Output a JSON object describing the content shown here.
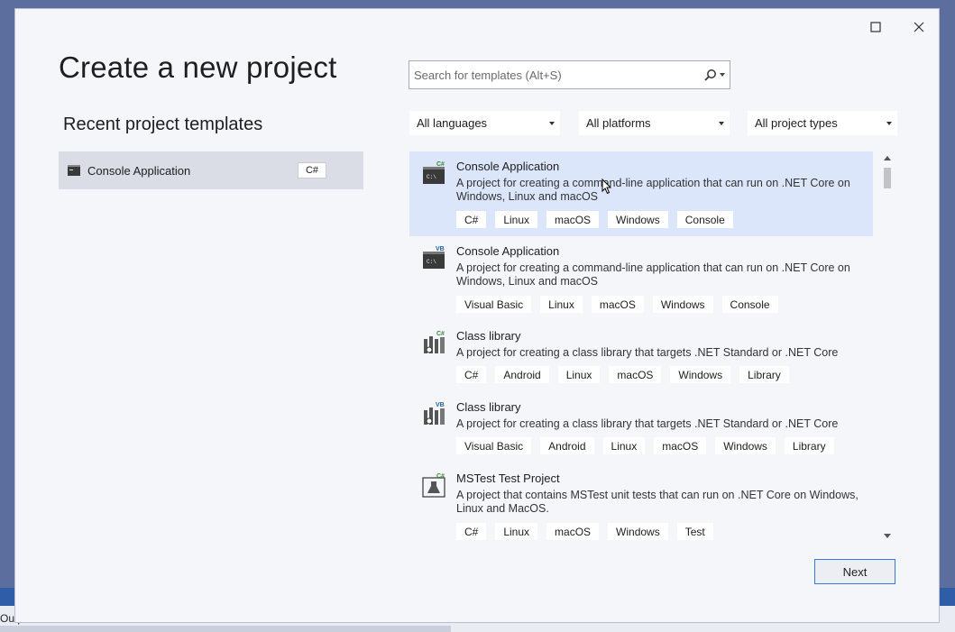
{
  "background": {
    "output_label": "Outpu",
    "accent": "#2f5da8"
  },
  "dialog": {
    "title": "Create a new project",
    "window_controls": {
      "maximize_icon": "maximize-icon",
      "close_icon": "close-icon"
    }
  },
  "recent": {
    "heading": "Recent project templates",
    "items": [
      {
        "label": "Console Application",
        "language": "C#"
      }
    ]
  },
  "search": {
    "placeholder": "Search for templates (Alt+S)",
    "value": ""
  },
  "filters": {
    "language": "All languages",
    "platform": "All platforms",
    "project_type": "All project types"
  },
  "templates": [
    {
      "name": "Console Application",
      "lang_badge": "C#",
      "description": "A project for creating a command-line application that can run on .NET Core on Windows, Linux and macOS",
      "tags": [
        "C#",
        "Linux",
        "macOS",
        "Windows",
        "Console"
      ],
      "selected": true
    },
    {
      "name": "Console Application",
      "lang_badge": "VB",
      "description": "A project for creating a command-line application that can run on .NET Core on Windows, Linux and macOS",
      "tags": [
        "Visual Basic",
        "Linux",
        "macOS",
        "Windows",
        "Console"
      ],
      "selected": false
    },
    {
      "name": "Class library",
      "lang_badge": "C#",
      "description": "A project for creating a class library that targets .NET Standard or .NET Core",
      "tags": [
        "C#",
        "Android",
        "Linux",
        "macOS",
        "Windows",
        "Library"
      ],
      "selected": false
    },
    {
      "name": "Class library",
      "lang_badge": "VB",
      "description": "A project for creating a class library that targets .NET Standard or .NET Core",
      "tags": [
        "Visual Basic",
        "Android",
        "Linux",
        "macOS",
        "Windows",
        "Library"
      ],
      "selected": false
    },
    {
      "name": "MSTest Test Project",
      "lang_badge": "C#",
      "description": "A project that contains MSTest unit tests that can run on .NET Core on Windows, Linux and MacOS.",
      "tags": [
        "C#",
        "Linux",
        "macOS",
        "Windows",
        "Test"
      ],
      "selected": false
    }
  ],
  "buttons": {
    "next": "Next"
  },
  "colors": {
    "selected_row": "#dce6fb",
    "csharp_badge": "#388a34",
    "vb_badge": "#1e5fa8",
    "focus_border": "#3c78d8"
  }
}
